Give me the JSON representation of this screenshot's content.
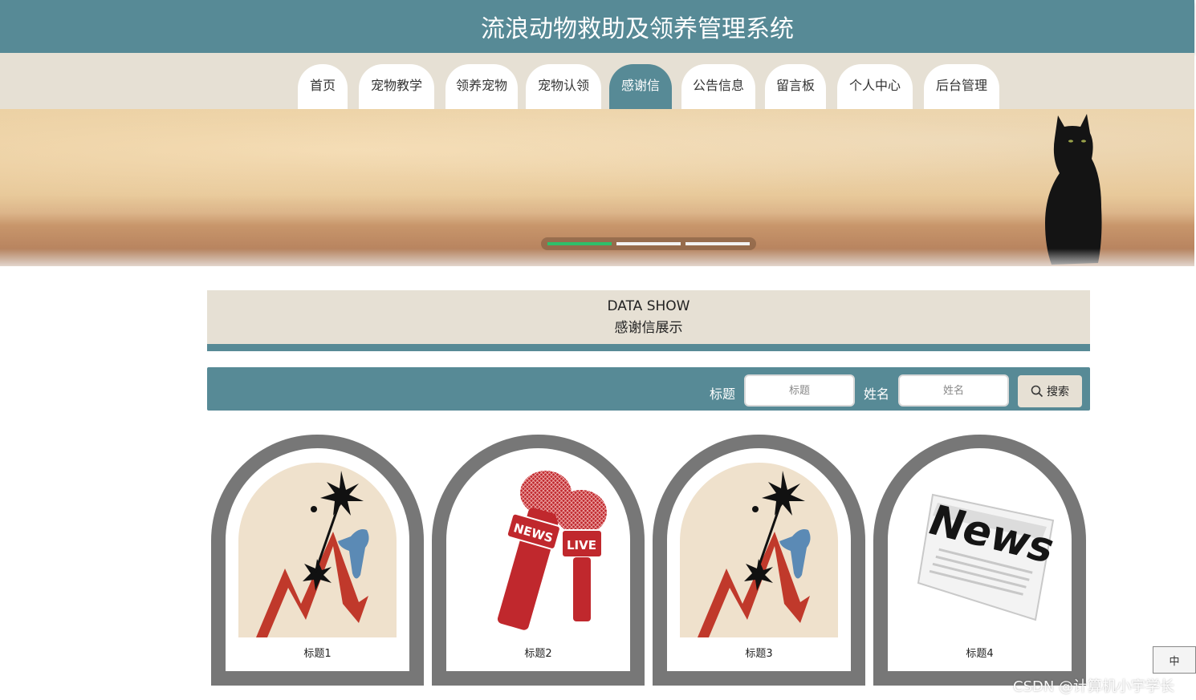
{
  "header": {
    "title": "流浪动物救助及领养管理系统"
  },
  "nav": {
    "items": [
      {
        "label": "首页",
        "active": false
      },
      {
        "label": "宠物教学",
        "active": false
      },
      {
        "label": "领养宠物",
        "active": false
      },
      {
        "label": "宠物认领",
        "active": false
      },
      {
        "label": "感谢信",
        "active": true
      },
      {
        "label": "公告信息",
        "active": false
      },
      {
        "label": "留言板",
        "active": false
      },
      {
        "label": "个人中心",
        "active": false
      },
      {
        "label": "后台管理",
        "active": false
      }
    ]
  },
  "banner": {
    "slides": 3,
    "current_slide": 1
  },
  "section": {
    "title_en": "DATA SHOW",
    "title_cn": "感谢信展示"
  },
  "search": {
    "title_label": "标题",
    "title_placeholder": "标题",
    "name_label": "姓名",
    "name_placeholder": "姓名",
    "button_label": "搜索"
  },
  "cards": [
    {
      "caption": "标题1",
      "image": "crisis-chart-illustration"
    },
    {
      "caption": "标题2",
      "image": "news-live-microphones"
    },
    {
      "caption": "标题3",
      "image": "crisis-chart-illustration"
    },
    {
      "caption": "标题4",
      "image": "news-newspaper"
    }
  ],
  "colors": {
    "primary": "#578a96",
    "beige": "#e6e0d4",
    "card_frame": "#777777",
    "slide_active": "#2ebf6a"
  },
  "ime": {
    "label": "中"
  },
  "watermark": "CSDN @计算机小宇学长"
}
